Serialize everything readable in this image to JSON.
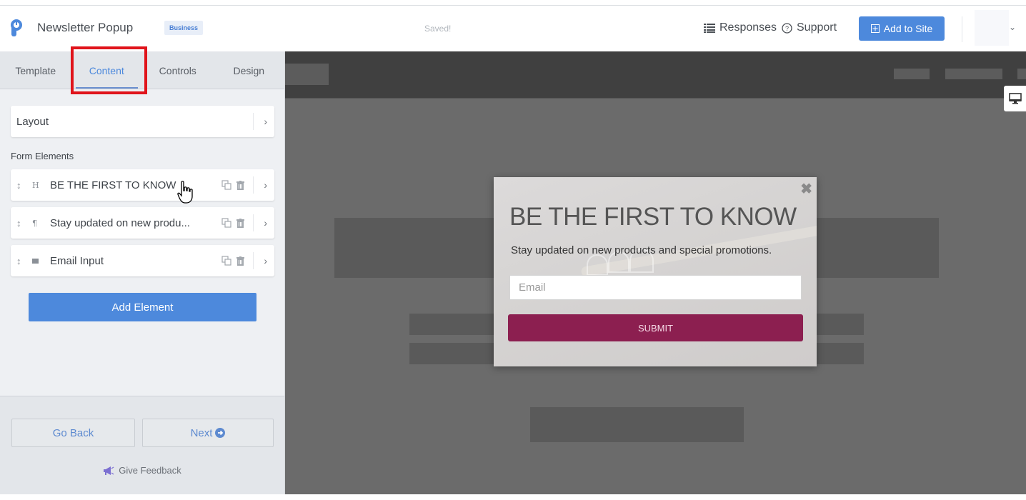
{
  "header": {
    "app_title": "Newsletter Popup",
    "plan_badge": "Business",
    "save_status": "Saved!",
    "responses_label": "Responses",
    "support_label": "Support",
    "add_to_site_label": "Add to Site"
  },
  "sidebar": {
    "tabs": [
      {
        "label": "Template",
        "active": false
      },
      {
        "label": "Content",
        "active": true
      },
      {
        "label": "Controls",
        "active": false
      },
      {
        "label": "Design",
        "active": false
      }
    ],
    "layout_label": "Layout",
    "form_elements_title": "Form Elements",
    "elements": [
      {
        "type_icon": "H",
        "type": "heading",
        "label": "BE THE FIRST TO KNOW"
      },
      {
        "type_icon": "¶",
        "type": "paragraph",
        "label": "Stay updated on new produ..."
      },
      {
        "type_icon": "✉",
        "type": "email",
        "label": "Email Input"
      }
    ],
    "add_element_label": "Add Element",
    "go_back_label": "Go Back",
    "next_label": "Next",
    "feedback_label": "Give Feedback"
  },
  "popup": {
    "title": "BE THE FIRST TO KNOW",
    "subtitle": "Stay updated on new products and special promotions.",
    "email_placeholder": "Email",
    "submit_label": "SUBMIT",
    "close_glyph": "✖"
  },
  "colors": {
    "accent": "#4d89dc",
    "submit": "#8c1f50",
    "highlight": "#e0141b"
  }
}
